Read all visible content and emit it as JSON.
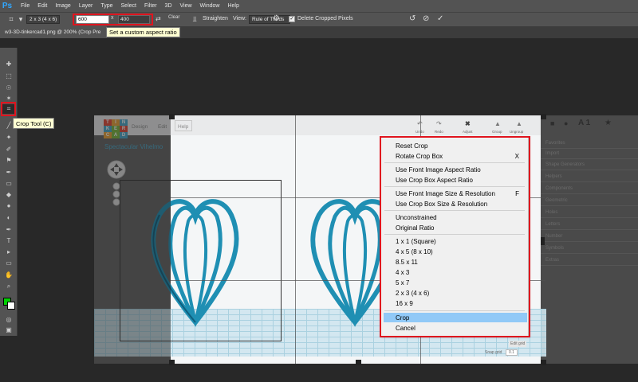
{
  "app": {
    "logo": "Ps",
    "menu": [
      "File",
      "Edit",
      "Image",
      "Layer",
      "Type",
      "Select",
      "Filter",
      "3D",
      "View",
      "Window",
      "Help"
    ]
  },
  "options": {
    "preset": "2 x 3 (4 x 6)",
    "width_value": "600",
    "times": "x",
    "height_value": "400",
    "clear_label": "Clear",
    "straighten_label": "Straighten",
    "view_label": "View:",
    "view_value": "Rule of Thirds",
    "delete_cropped_label": "Delete Cropped Pixels",
    "delete_cropped_checked": true
  },
  "document": {
    "tab_title": "w3-3D-tinkercad1.png @ 200% (Crop Pre",
    "tooltip": "Set a custom aspect ratio"
  },
  "tools": {
    "crop_tooltip": "Crop Tool (C)",
    "foreground_color": "#00d000",
    "background_color": "#ffffff"
  },
  "tinkercad": {
    "logo_letters": [
      "T",
      "I",
      "N",
      "K",
      "E",
      "R",
      "C",
      "A",
      "D"
    ],
    "menu": [
      "Design",
      "Edit",
      "Help"
    ],
    "title": "Spectacular Vihelmo",
    "toolbar": [
      "Undo",
      "Redo",
      "Adjust",
      "Group",
      "Ungroup"
    ],
    "panel_header": "A 1",
    "panel_items": [
      "Favorites",
      "Import",
      "Shape Generators",
      "Helpers",
      "Components",
      "Geometric",
      "Holes",
      "Letters",
      "Number",
      "Symbols",
      "Extras"
    ],
    "edit_grid": "Edit grid",
    "snap_grid_label": "Snap grid",
    "snap_grid_value": "0.1"
  },
  "context_menu": {
    "groups": [
      [
        {
          "label": "Reset Crop",
          "shortcut": ""
        },
        {
          "label": "Rotate Crop Box",
          "shortcut": "X"
        }
      ],
      [
        {
          "label": "Use Front Image Aspect Ratio",
          "shortcut": ""
        },
        {
          "label": "Use Crop Box Aspect Ratio",
          "shortcut": ""
        }
      ],
      [
        {
          "label": "Use Front Image Size & Resolution",
          "shortcut": "F"
        },
        {
          "label": "Use Crop Box Size & Resolution",
          "shortcut": ""
        }
      ],
      [
        {
          "label": "Unconstrained",
          "shortcut": ""
        },
        {
          "label": "Original Ratio",
          "shortcut": ""
        }
      ],
      [
        {
          "label": "1 x 1 (Square)",
          "shortcut": ""
        },
        {
          "label": "4 x 5 (8 x 10)",
          "shortcut": ""
        },
        {
          "label": "8.5 x 11",
          "shortcut": ""
        },
        {
          "label": "4 x 3",
          "shortcut": ""
        },
        {
          "label": "5 x 7",
          "shortcut": ""
        },
        {
          "label": "2 x 3 (4 x 6)",
          "shortcut": ""
        },
        {
          "label": "16 x 9",
          "shortcut": ""
        }
      ],
      [
        {
          "label": "Crop",
          "shortcut": "",
          "selected": true
        },
        {
          "label": "Cancel",
          "shortcut": ""
        }
      ]
    ]
  },
  "colors": {
    "highlight_red": "#e0141e",
    "ps_blue": "#31a8ff",
    "menu_selection": "#91c9f7",
    "heart_teal": "#1f8fb3"
  }
}
